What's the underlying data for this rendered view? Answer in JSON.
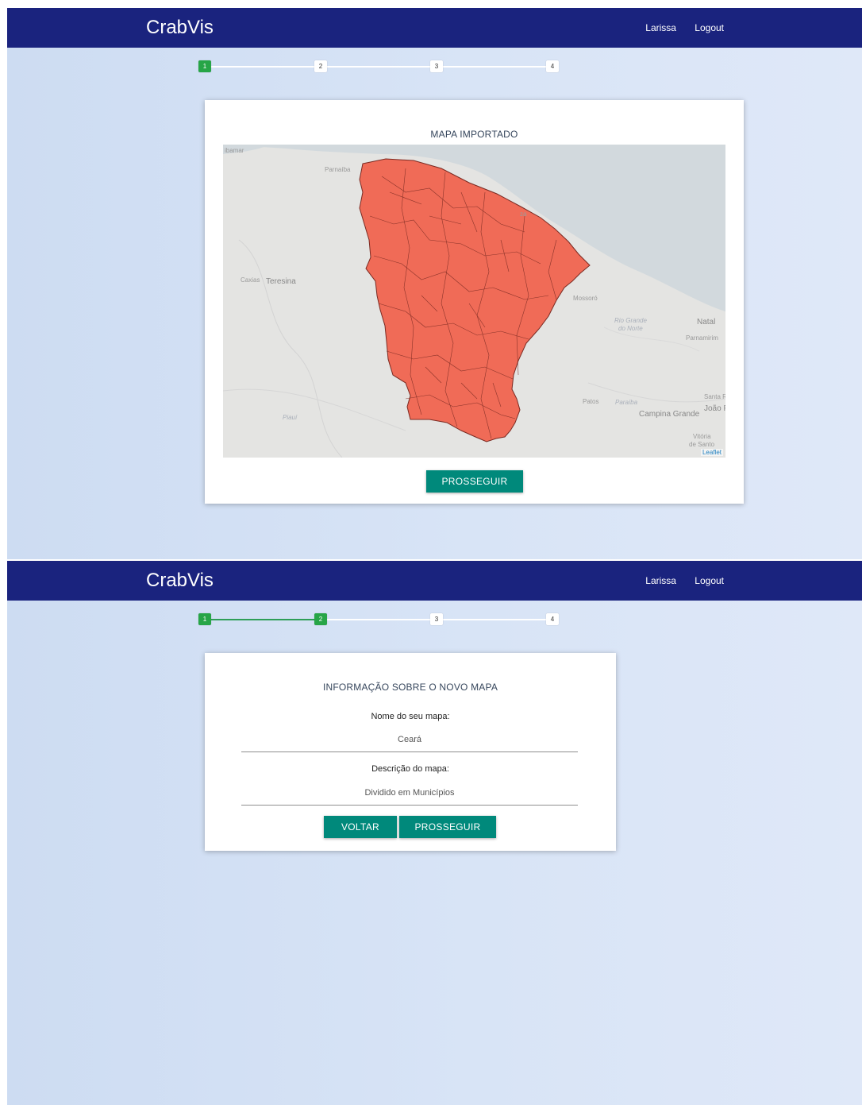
{
  "app": {
    "brand": "CrabVis",
    "user": "Larissa",
    "logout": "Logout"
  },
  "steps": [
    "1",
    "2",
    "3",
    "4"
  ],
  "screen1": {
    "title": "MAPA IMPORTADO",
    "button": "PROSSEGUIR",
    "active_steps": 1,
    "map": {
      "attribution": "Leaflet",
      "fill_color": "#f06b57",
      "labels": [
        "Parnaíba",
        "Teresina",
        "Caxias",
        "Mossoró",
        "Rio Grande",
        "do Norte",
        "Natal",
        "Parnamirim",
        "Patos",
        "Paraíba",
        "Campina Grande",
        "João P",
        "Santa R",
        "Vitória",
        "de Santo",
        "Piauí",
        "ibamar",
        "za"
      ]
    }
  },
  "screen2": {
    "title": "INFORMAÇÃO SOBRE O NOVO MAPA",
    "name_label": "Nome do seu mapa:",
    "name_value": "Ceará",
    "desc_label": "Descrição do mapa:",
    "desc_value": "Dividido em Municípios",
    "back_button": "VOLTAR",
    "next_button": "PROSSEGUIR",
    "active_steps": 2
  }
}
